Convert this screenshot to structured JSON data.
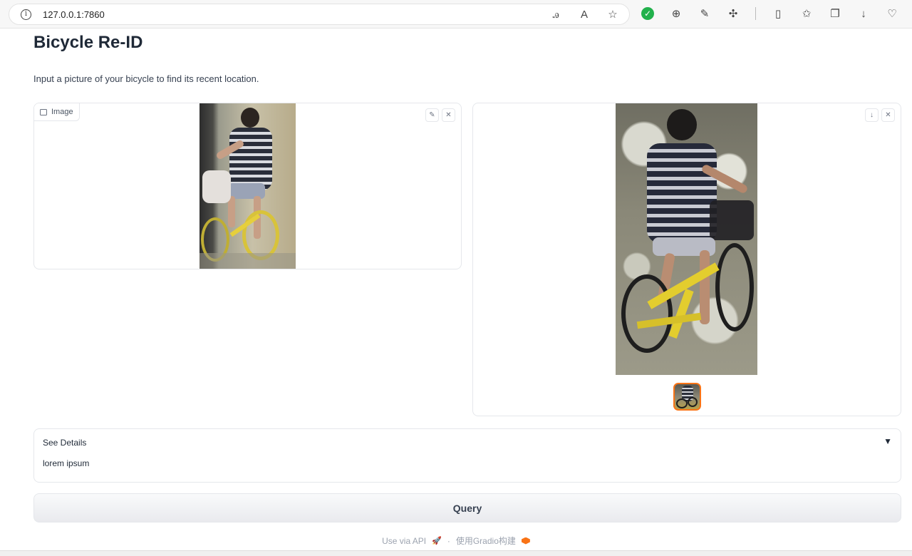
{
  "browser": {
    "url": "127.0.0.1:7860",
    "info_icon": "info-icon",
    "address_actions": [
      "translate-icon",
      "read-aloud-icon",
      "favorite-star-icon"
    ],
    "toolbar_icons": [
      "green-check-extension-icon",
      "zoom-icon",
      "edit-icon",
      "extensions-icon",
      "split-screen-icon",
      "favorites-icon",
      "collections-icon",
      "download-icon",
      "profile-icon"
    ]
  },
  "page": {
    "title": "Bicycle Re-ID",
    "description": "Input a picture of your bicycle to find its recent location."
  },
  "input_image": {
    "label": "Image",
    "label_icon": "image-icon",
    "buttons": [
      "edit-icon",
      "close-icon"
    ]
  },
  "output_gallery": {
    "buttons": [
      "download-icon",
      "close-icon"
    ],
    "thumbnail_selected": true
  },
  "details": {
    "title": "See Details",
    "arrow": "▼",
    "body": "lorem ipsum"
  },
  "query_button": {
    "label": "Query"
  },
  "footer": {
    "api_text": "Use via API",
    "separator": "·",
    "built_with": "使用Gradio构建"
  },
  "colors": {
    "accent": "#f97316",
    "status_green": "#22b14c"
  }
}
